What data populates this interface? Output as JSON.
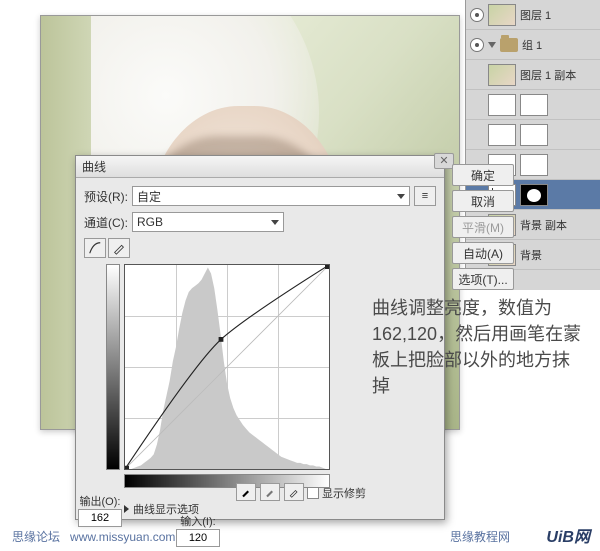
{
  "layers": {
    "rows": [
      {
        "label": "图层 1",
        "kind": "photo"
      },
      {
        "label": "组 1",
        "kind": "folder"
      },
      {
        "label": "图层 1 副本",
        "kind": "photo"
      },
      {
        "label": "",
        "kind": "adjust"
      },
      {
        "label": "",
        "kind": "adjust"
      },
      {
        "label": "",
        "kind": "adjust"
      },
      {
        "label": "",
        "kind": "curves-sel"
      },
      {
        "label": "背景 副本",
        "kind": "photo"
      },
      {
        "label": "背景",
        "kind": "photo"
      }
    ]
  },
  "dialog": {
    "title": "曲线",
    "preset_label": "预设(R):",
    "preset_value": "自定",
    "channel_label": "通道(C):",
    "channel_value": "RGB",
    "output_label": "输出(O):",
    "output_value": "162",
    "input_label": "输入(I):",
    "input_value": "120",
    "show_clip": "显示修剪",
    "display_options": "曲线显示选项",
    "buttons": {
      "ok": "确定",
      "cancel": "取消",
      "smooth": "平滑(M)",
      "auto": "自动(A)",
      "options": "选项(T)..."
    }
  },
  "chart_data": {
    "type": "line",
    "title": "曲线",
    "xlabel": "输入",
    "ylabel": "输出",
    "xlim": [
      0,
      255
    ],
    "ylim": [
      0,
      255
    ],
    "series": [
      {
        "name": "curve",
        "points": [
          [
            0,
            0
          ],
          [
            120,
            162
          ],
          [
            255,
            255
          ]
        ]
      },
      {
        "name": "baseline",
        "points": [
          [
            0,
            0
          ],
          [
            255,
            255
          ]
        ]
      }
    ],
    "control_point": {
      "input": 120,
      "output": 162
    },
    "histogram": [
      0,
      0,
      0,
      1,
      2,
      3,
      5,
      7,
      9,
      12,
      20,
      32,
      48,
      60,
      72,
      88,
      100,
      115,
      128,
      138,
      145,
      148,
      150,
      152,
      155,
      160,
      165,
      160,
      148,
      130,
      110,
      88,
      70,
      58,
      50,
      44,
      40,
      36,
      33,
      30,
      28,
      26,
      24,
      22,
      20,
      18,
      16,
      14,
      12,
      10,
      9,
      8,
      7,
      6,
      5,
      5,
      4,
      4,
      3,
      3,
      2,
      2,
      1,
      0
    ]
  },
  "annotation": "曲线调整亮度，数值为162,120，然后用画笔在蒙板上把脸部以外的地方抹掉",
  "credits": {
    "forum": "思缘论坛",
    "url": "www.missyuan.com",
    "right": "思缘教程网",
    "logo_a": "UiB",
    "logo_b": "网"
  }
}
